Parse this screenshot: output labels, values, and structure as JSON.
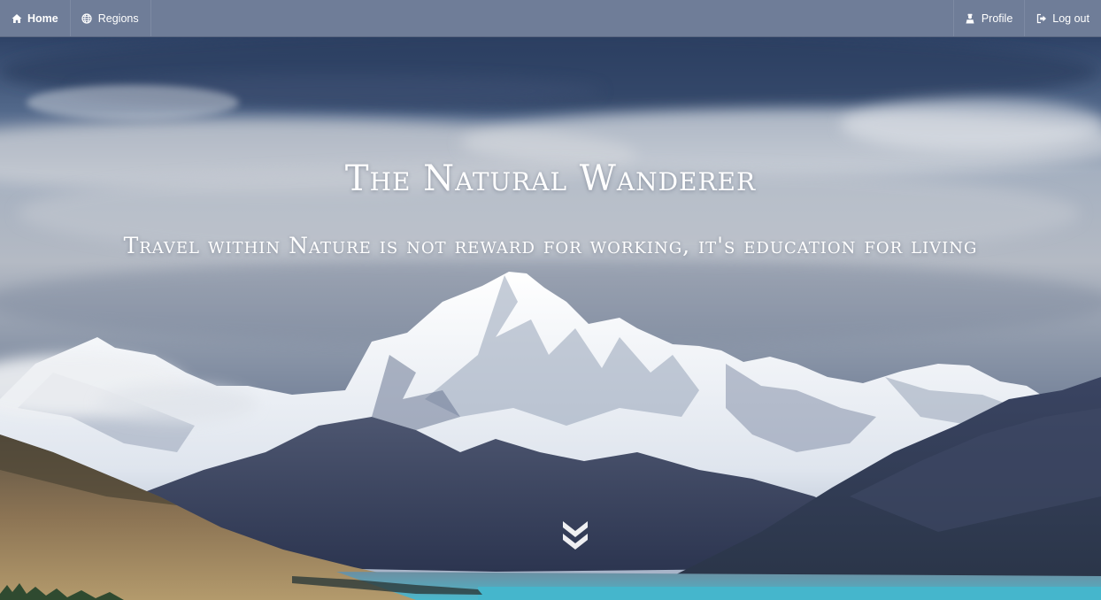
{
  "nav": {
    "left": [
      {
        "label": "Home",
        "icon": "home-icon",
        "active": true
      },
      {
        "label": "Regions",
        "icon": "globe-icon",
        "active": false
      }
    ],
    "right": [
      {
        "label": "Profile",
        "icon": "user-icon"
      },
      {
        "label": "Log out",
        "icon": "logout-icon"
      }
    ]
  },
  "hero": {
    "title": "The Natural Wanderer",
    "subtitle": "Travel within Nature is not reward for working, it's education for living",
    "scroll_icon": "double-chevron-down-icon"
  },
  "colors": {
    "navbar": "#6f7d98",
    "sky_top": "#2f4466",
    "lake": "#4ab3c8"
  }
}
